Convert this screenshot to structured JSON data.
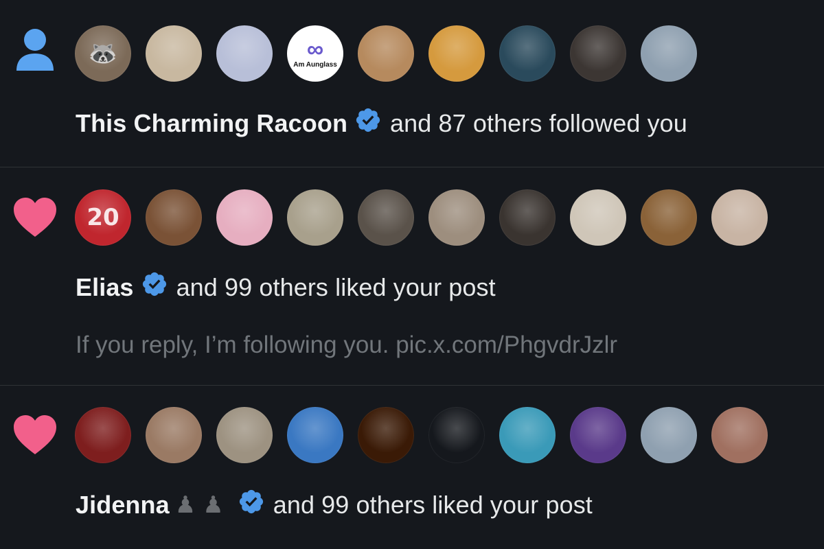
{
  "colors": {
    "background": "#15181d",
    "divider": "#2f3336",
    "text_primary": "#e7e9ea",
    "text_secondary": "#71767b",
    "follow_icon": "#5ba4f0",
    "like_icon": "#f2608b",
    "verified_badge": "#4d98e8"
  },
  "notifications": [
    {
      "type": "follow",
      "icon": "person-icon",
      "actor": "This Charming Racoon",
      "verified": true,
      "action_text": "and 87 others followed you",
      "avatars": [
        {
          "name": "raccoon-avatar",
          "glyph": "🦝",
          "color": "#7c6a58"
        },
        {
          "name": "woman-avatar",
          "glyph": "",
          "color": "#c8b8a0"
        },
        {
          "name": "white-fabric-avatar",
          "glyph": "",
          "color": "#b8bfd8"
        },
        {
          "name": "am-aunglass-logo-avatar",
          "glyph": "∞",
          "color": "#ffffff",
          "text": "Am Aunglass"
        },
        {
          "name": "man-avatar",
          "glyph": "",
          "color": "#b68a5e"
        },
        {
          "name": "food-avatar",
          "glyph": "",
          "color": "#d59a3e"
        },
        {
          "name": "blue-abstract-avatar",
          "glyph": "",
          "color": "#2a4a5c"
        },
        {
          "name": "dark-banner-avatar",
          "glyph": "",
          "color": "#3c3633"
        },
        {
          "name": "man-profile-avatar",
          "glyph": "",
          "color": "#8fa0b0"
        }
      ]
    },
    {
      "type": "like",
      "icon": "heart-icon",
      "actor": "Elias",
      "verified": true,
      "action_text": "and 99 others liked your post",
      "preview": "If you reply, I’m following you. pic.x.com/PhgvdrJzlr",
      "avatars": [
        {
          "name": "football-player-avatar",
          "glyph": "20",
          "color": "#c0262e"
        },
        {
          "name": "curly-hair-woman-avatar",
          "glyph": "",
          "color": "#7a5236"
        },
        {
          "name": "cartoon-bear-avatar",
          "glyph": "",
          "color": "#e6aec0"
        },
        {
          "name": "robot-avatar",
          "glyph": "",
          "color": "#a8a08c"
        },
        {
          "name": "masked-figure-avatar",
          "glyph": "",
          "color": "#5a524a"
        },
        {
          "name": "man-white-shirt-avatar",
          "glyph": "",
          "color": "#9d8e7e"
        },
        {
          "name": "black-cat-avatar",
          "glyph": "",
          "color": "#3a3430"
        },
        {
          "name": "floral-pattern-avatar",
          "glyph": "",
          "color": "#cfc6b8"
        },
        {
          "name": "boy-avatar",
          "glyph": "",
          "color": "#8a6238"
        },
        {
          "name": "smiling-woman-avatar",
          "glyph": "",
          "color": "#c8b4a4"
        }
      ]
    },
    {
      "type": "like",
      "icon": "heart-icon",
      "actor": "Jidenna",
      "actor_suffix": "♟♟",
      "verified": true,
      "action_text": "and 99 others liked your post",
      "avatars": [
        {
          "name": "afro-man-avatar",
          "glyph": "",
          "color": "#7e1e1e"
        },
        {
          "name": "woman-portrait-avatar",
          "glyph": "",
          "color": "#9a7a64"
        },
        {
          "name": "astronaut-avatar",
          "glyph": "",
          "color": "#9d9281"
        },
        {
          "name": "cartoon-boy-avatar",
          "glyph": "",
          "color": "#3a78c2"
        },
        {
          "name": "eclipse-avatar",
          "glyph": "",
          "color": "#3a1a06"
        },
        {
          "name": "skull-hand-avatar",
          "glyph": "",
          "color": "#15181d"
        },
        {
          "name": "man-cap-avatar",
          "glyph": "",
          "color": "#3a9ab8"
        },
        {
          "name": "vr-headset-avatar",
          "glyph": "",
          "color": "#5a3a8a"
        },
        {
          "name": "man-profile-avatar-2",
          "glyph": "",
          "color": "#8fa0b0"
        },
        {
          "name": "man-street-avatar",
          "glyph": "",
          "color": "#a07060"
        }
      ]
    }
  ]
}
